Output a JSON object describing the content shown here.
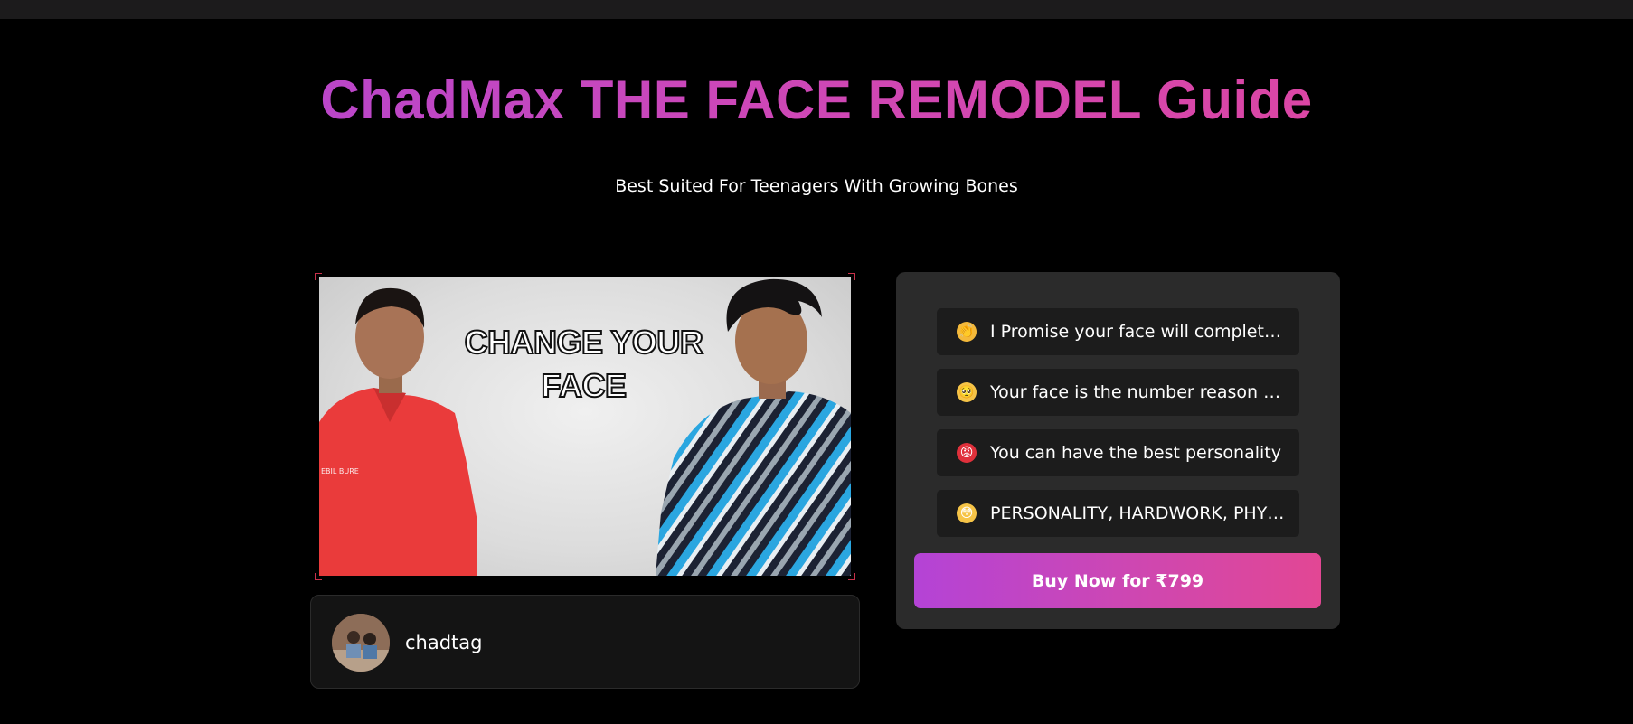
{
  "page": {
    "title": "ChadMax THE FACE REMODEL Guide",
    "subtitle": "Best Suited For Teenagers With Growing Bones"
  },
  "product_image": {
    "overlay_text_line1": "CHANGE YOUR",
    "overlay_text_line2": "FACE",
    "shirt_print": "EBIL BURE"
  },
  "creator": {
    "name": "chadtag"
  },
  "features": [
    {
      "icon": "clapping-hands-icon",
      "emoji": "👏",
      "text": "I Promise your face will completely change"
    },
    {
      "icon": "pleading-face-icon",
      "emoji": "🥺",
      "text": "Your face is the number reason why"
    },
    {
      "icon": "angry-face-icon",
      "emoji": "😡",
      "text": "You can have the best personality"
    },
    {
      "icon": "flushed-face-icon",
      "emoji": "😳",
      "text": "PERSONALITY, HARDWORK, PHYSIQUE"
    }
  ],
  "buy_button": {
    "label": "Buy Now for ₹799"
  },
  "colors": {
    "background": "#000000",
    "top_bar": "#1c1b1c",
    "panel": "#2b2b2b",
    "feature_item": "#1c1c1c",
    "accent_start": "#b443d6",
    "accent_end": "#e24794"
  }
}
